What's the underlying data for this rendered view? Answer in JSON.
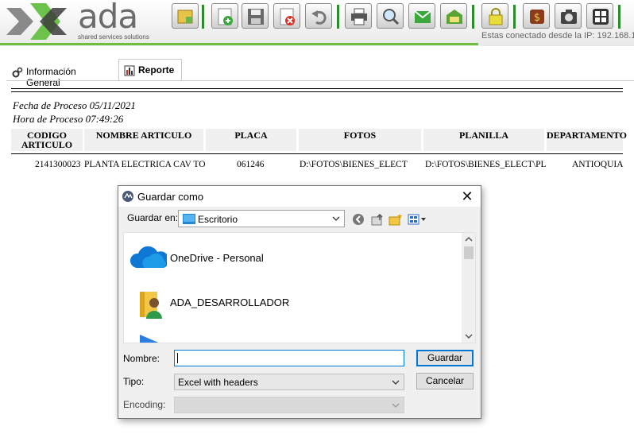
{
  "app": {
    "logo_word": "ada",
    "logo_tagline": "shared services solutions",
    "ip_text": "Estas conectado desde la IP: 192.168.1"
  },
  "toolbar": {
    "buttons": [
      "folder-edit-icon",
      "add-icon",
      "save-icon",
      "delete-icon",
      "undo-icon",
      "print-icon",
      "search-icon",
      "export-icon",
      "email-icon",
      "lock-icon",
      "money-icon",
      "camera-icon",
      "grid-icon"
    ]
  },
  "tabs": [
    {
      "label": "Información General",
      "icon": "gear-icon"
    },
    {
      "label": "Reporte",
      "icon": "chart-icon"
    }
  ],
  "report": {
    "fecha": "Fecha de Proceso 05/11/2021",
    "hora": "Hora de Proceso 07:49:26",
    "columns": [
      "CODIGO ARTICULO",
      "NOMBRE ARTICULO",
      "PLACA",
      "FOTOS",
      "PLANILLA",
      "DEPARTAMENTO"
    ],
    "rows": [
      [
        "2141300023",
        "PLANTA ELECTRICA CAV TO",
        "061246",
        "D:\\FOTOS\\BIENES_ELECT",
        "D:\\FOTOS\\BIENES_ELECT\\PL.",
        "ANTIOQUIA"
      ]
    ]
  },
  "dialog": {
    "title": "Guardar como",
    "close_glyph": "✕",
    "guardar_en_label": "Guardar en:",
    "guardar_en_value": "Escritorio",
    "items": [
      {
        "name": "OneDrive - Personal",
        "icon": "onedrive-cloud-icon"
      },
      {
        "name": "ADA_DESARROLLADOR",
        "icon": "user-folder-icon"
      }
    ],
    "nombre_label": "Nombre:",
    "nombre_value": "",
    "tipo_label": "Tipo:",
    "tipo_value": "Excel with headers",
    "encoding_label": "Encoding:",
    "encoding_value": "",
    "guardar_button": "Guardar",
    "cancelar_button": "Cancelar"
  },
  "colors": {
    "accent_blue": "#0078d7",
    "toolbar_green": "#2d8a2d",
    "onedrive_blue": "#0f78d4"
  }
}
